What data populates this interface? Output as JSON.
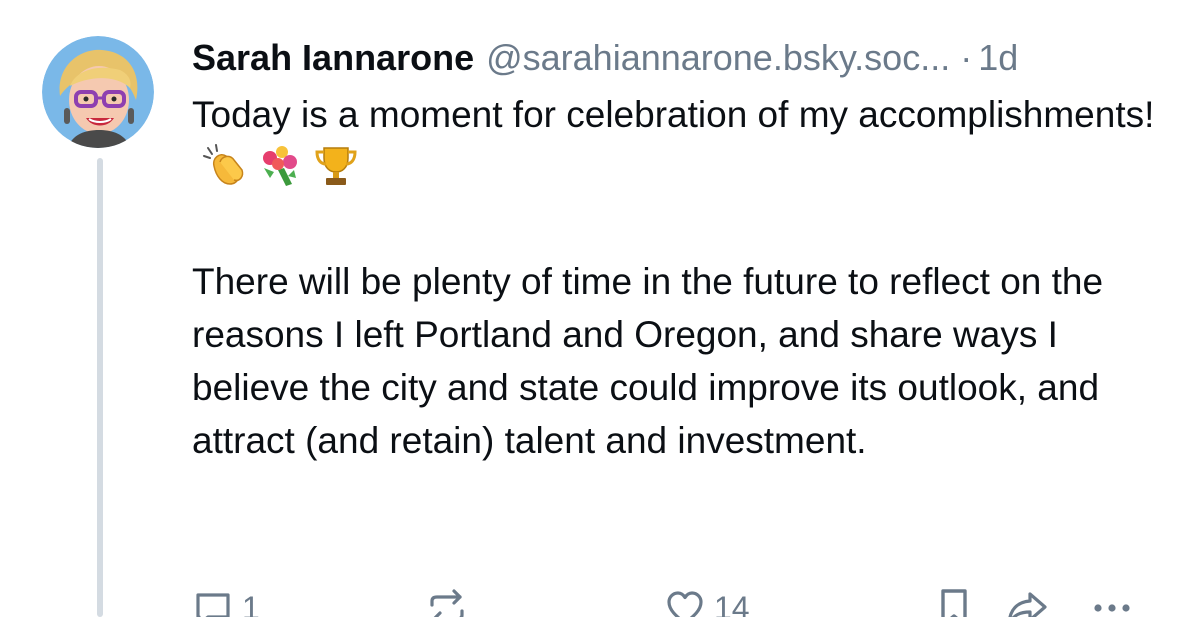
{
  "post": {
    "author": {
      "name": "Sarah Iannarone",
      "handle": "@sarahiannarone.bsky.soc...",
      "avatar_icon": "profile-avatar"
    },
    "separator": "·",
    "timestamp": "1d",
    "paragraphs": [
      "Today is a moment for celebration of my accomplishments!",
      "There will be plenty of time in the future to reflect on the reasons I left Portland and Oregon, and share ways I believe the city and state could improve its outlook, and attract (and retain) talent and investment."
    ],
    "emojis": [
      "👏",
      "💐",
      "🏆"
    ],
    "actions": {
      "reply_count": "1",
      "like_count": "14",
      "icons": [
        "reply-icon",
        "repost-icon",
        "like-icon",
        "bookmark-icon",
        "share-icon",
        "more-icon"
      ]
    }
  },
  "colors": {
    "text": "#0b0f14",
    "muted": "#6b7a8a",
    "thread_line": "#d4dbe2"
  }
}
